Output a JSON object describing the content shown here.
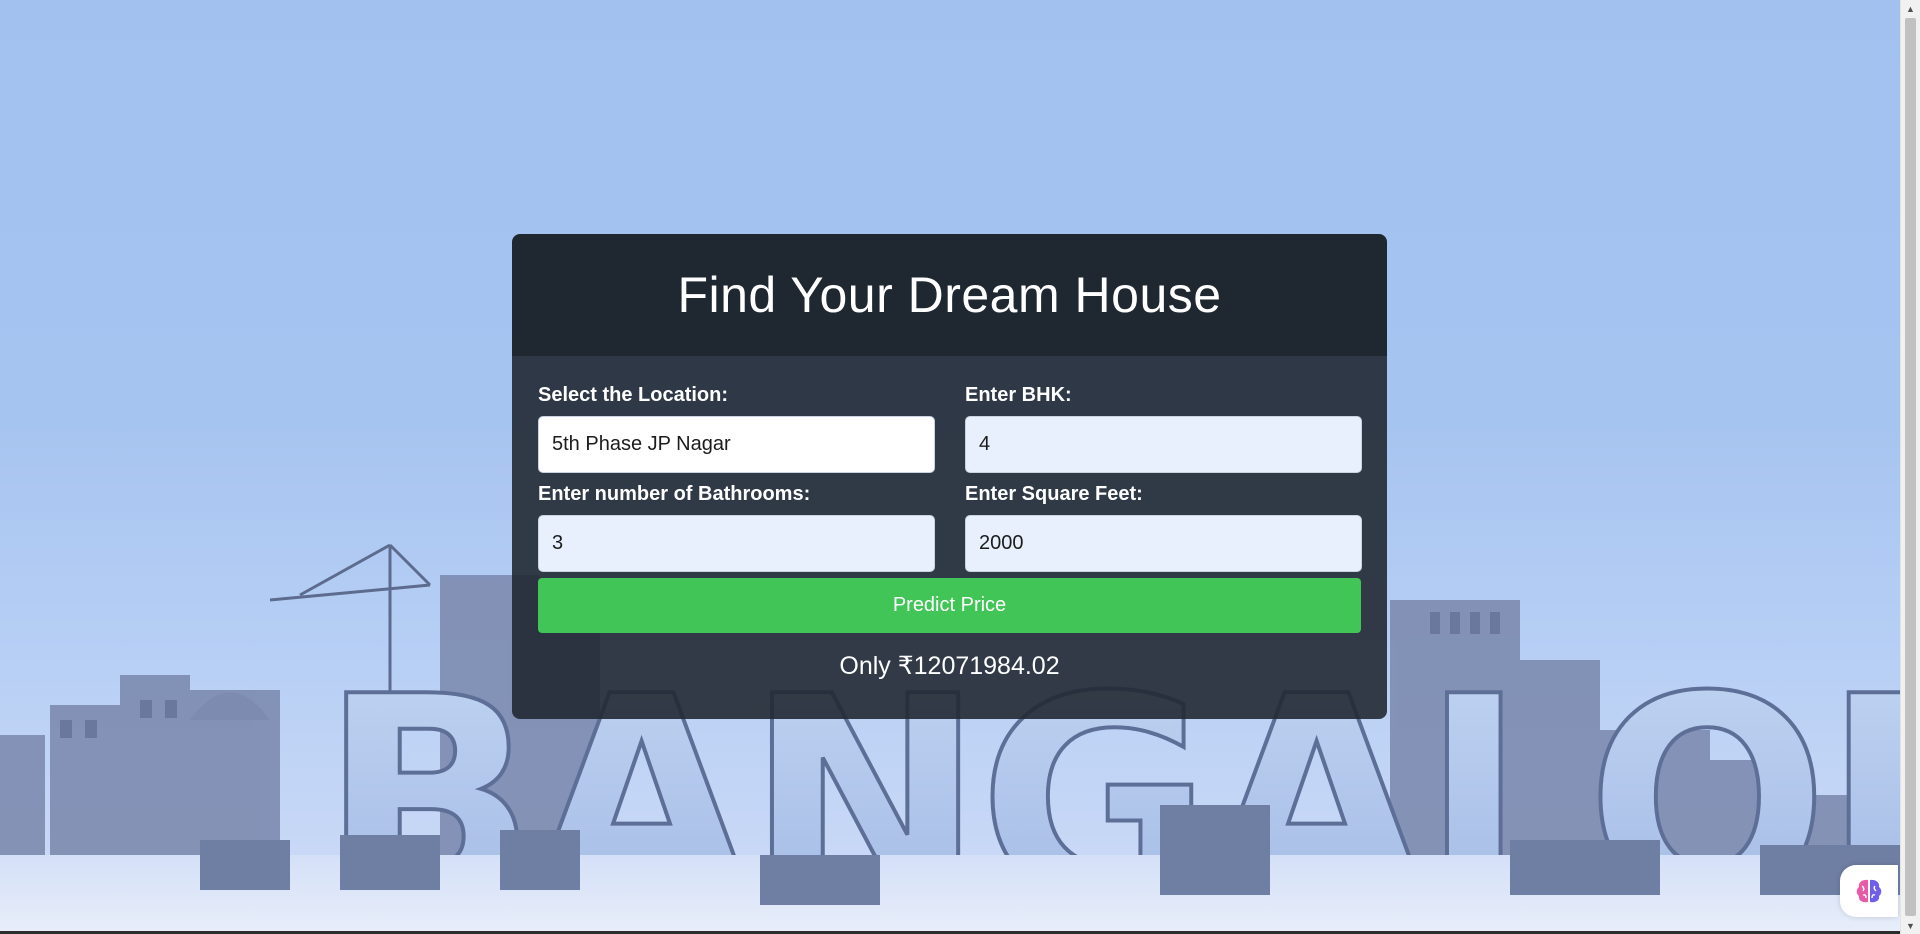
{
  "form": {
    "title": "Find Your Dream House",
    "location_label": "Select the Location:",
    "location_value": "5th Phase JP Nagar",
    "bhk_label": "Enter BHK:",
    "bhk_value": "4",
    "bathrooms_label": "Enter number of Bathrooms:",
    "bathrooms_value": "3",
    "sqft_label": "Enter Square Feet:",
    "sqft_value": "2000",
    "predict_label": "Predict Price",
    "result_text": "Only ₹12071984.02"
  },
  "background": {
    "city_text": "BANGALORE"
  },
  "icons": {
    "fab": "brain-icon",
    "scroll_up": "scroll-up-arrow-icon",
    "scroll_down": "scroll-down-arrow-icon"
  },
  "colors": {
    "header_bg": "#1f2730",
    "body_bg": "#222933",
    "button": "#40c556",
    "page_bg": "#a2c1ef"
  }
}
